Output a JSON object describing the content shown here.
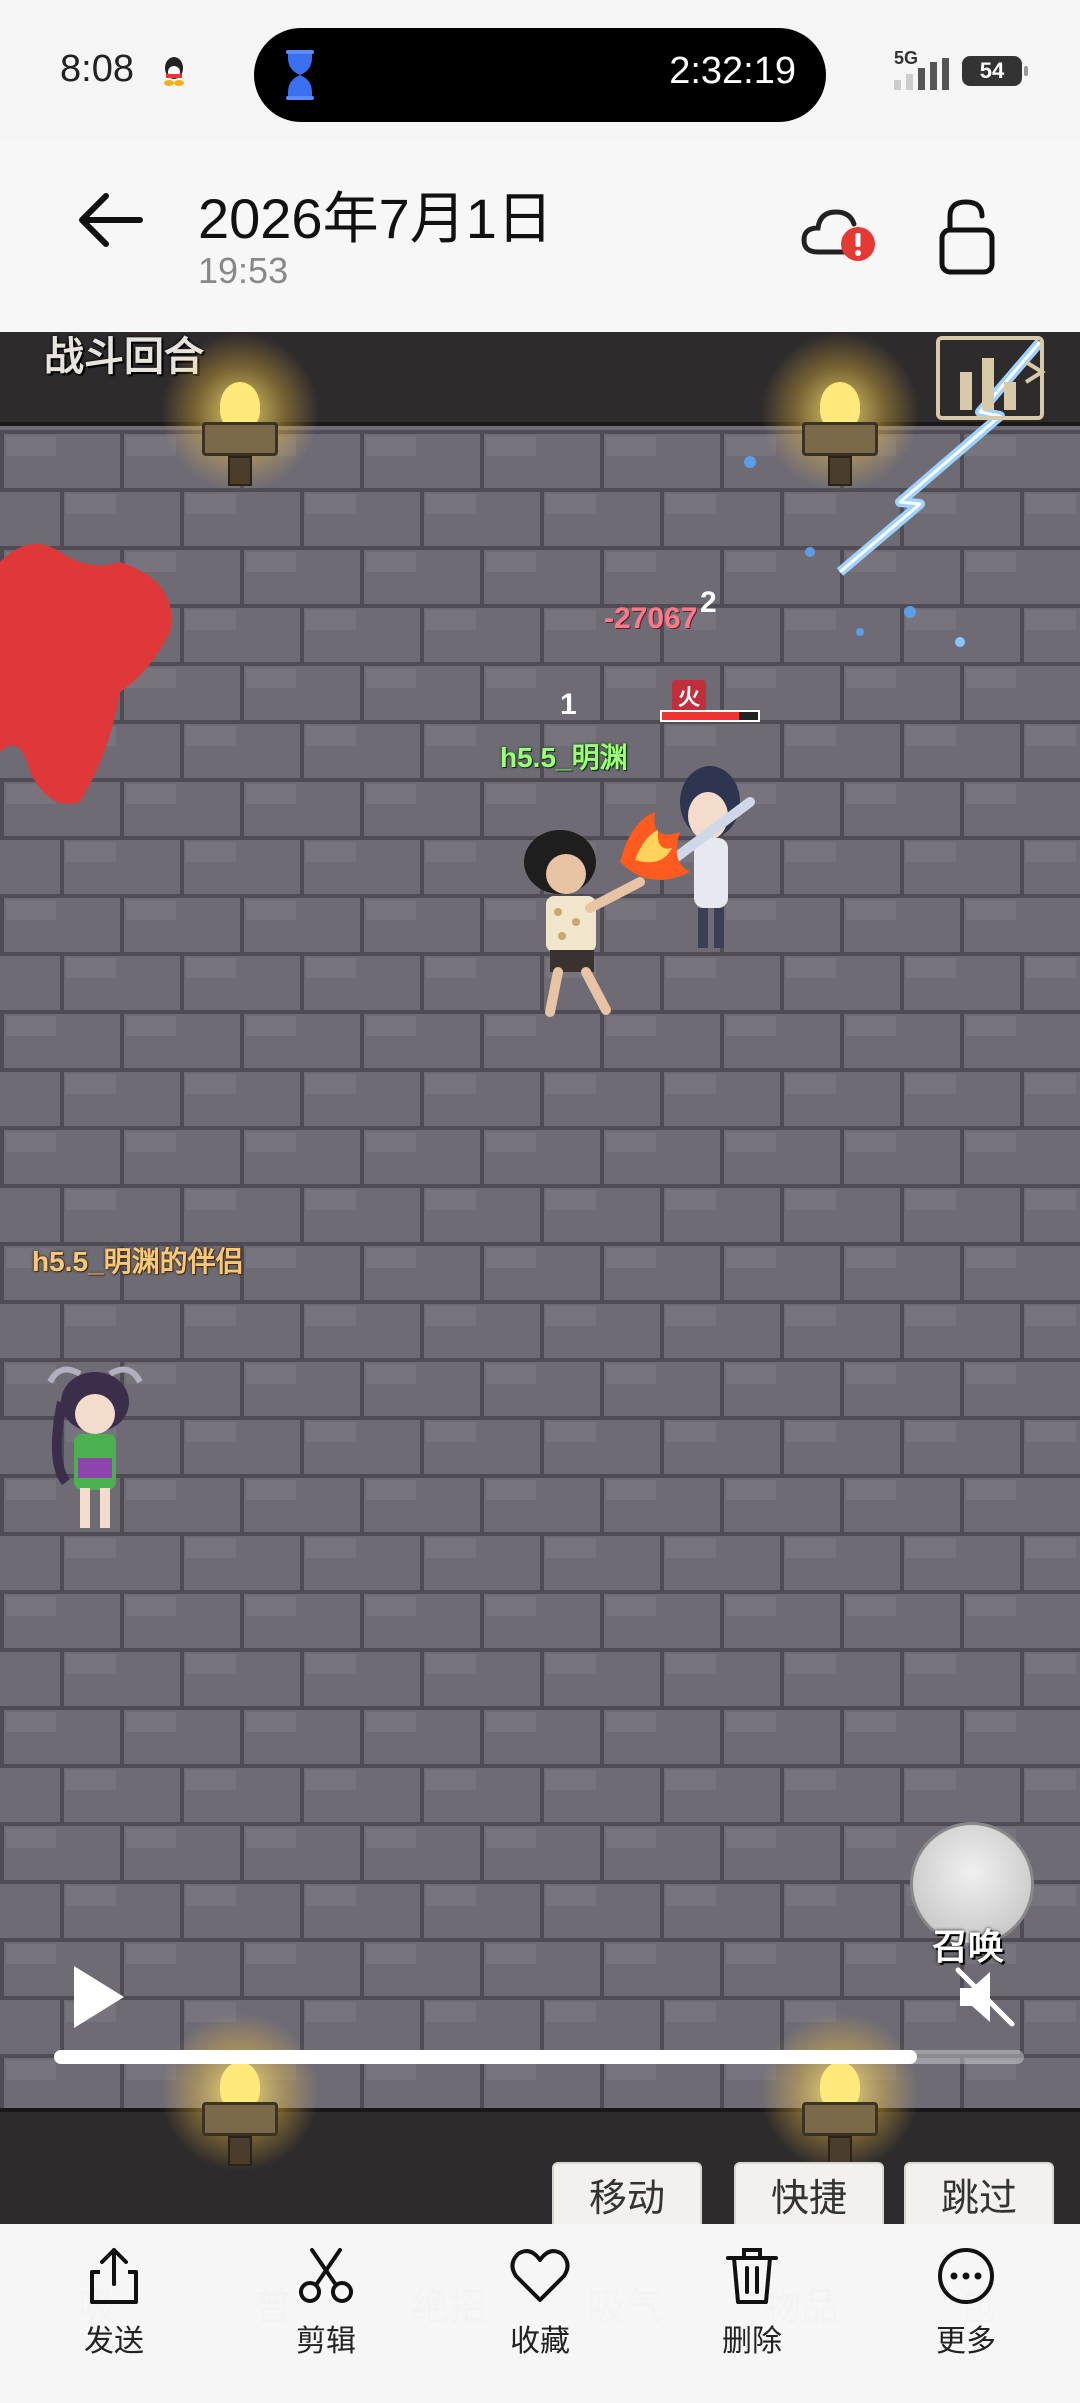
{
  "status_bar": {
    "time": "8:08",
    "island_timer": "2:32:19",
    "network": "5G",
    "battery": "54"
  },
  "header": {
    "title": "2026年7月1日",
    "subtitle": "19:53"
  },
  "game": {
    "round_label": "战斗回合",
    "damage_number": "-27067",
    "combo_2": "2",
    "combo_1": "1",
    "player_name": "h5.5_明渊",
    "enemy_status": "火",
    "enemy_hp_fraction": 0.8,
    "companion_name": "h5.5_明渊的伴侣",
    "summon_label": "召唤",
    "progress_fraction": 0.89,
    "actions": {
      "move": "移动",
      "quick": "快捷",
      "skip": "跳过"
    },
    "hidden_row": [
      "吸",
      "普",
      "绝招",
      "吸气",
      "物品",
      "包"
    ]
  },
  "toolbar": {
    "send": "发送",
    "edit": "剪辑",
    "favorite": "收藏",
    "delete": "删除",
    "more": "更多"
  },
  "colors": {
    "accent_blue": "#3a6ff0",
    "alert_red": "#e53935",
    "player_name": "#9bff7a",
    "companion_name": "#f6c97a",
    "damage": "#ff7a88"
  }
}
